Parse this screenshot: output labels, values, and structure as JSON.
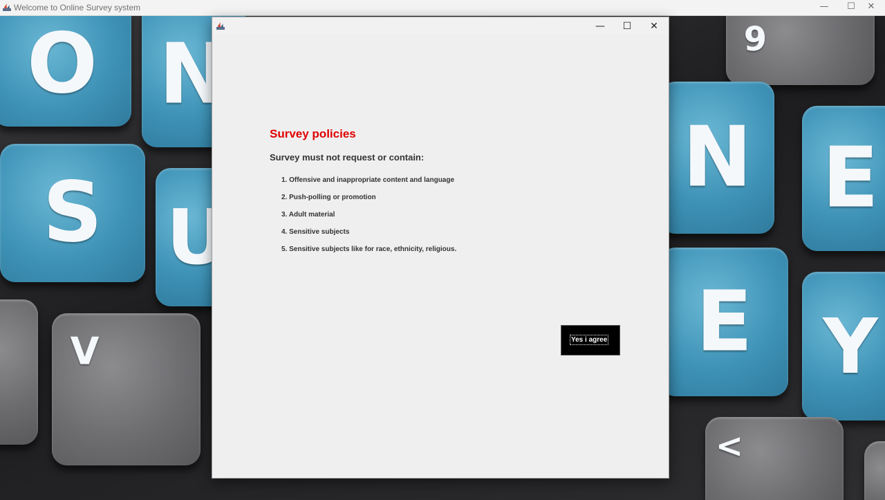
{
  "main_window": {
    "title": "Welcome to Online Survey system",
    "controls": {
      "minimize": "—",
      "maximize": "☐",
      "close": "✕"
    }
  },
  "background": {
    "keys": [
      "O",
      "N",
      "S",
      "U",
      "V",
      "9",
      "N",
      "E",
      "E",
      "Y",
      "<"
    ]
  },
  "dialog": {
    "controls": {
      "minimize": "—",
      "maximize": "☐",
      "close": "✕"
    },
    "heading": "Survey policies",
    "subheading": "Survey must not request or contain:",
    "items": [
      "1. Offensive and inappropriate content and language",
      "2. Push-polling or promotion",
      "3. Adult material",
      "4. Sensitive subjects",
      "5. Sensitive subjects like for race, ethnicity, religious."
    ],
    "agree_button": "Yes i agree"
  },
  "colors": {
    "heading": "#e00000",
    "button_bg": "#000000",
    "dialog_bg": "#efefef",
    "key_blue": "#3f93b7",
    "key_gray": "#6d6d70"
  },
  "icons": [
    "java-app-icon",
    "minimize-icon",
    "maximize-icon",
    "close-icon"
  ]
}
